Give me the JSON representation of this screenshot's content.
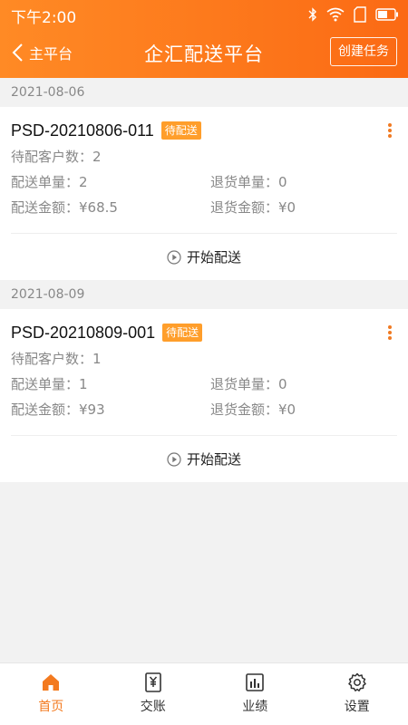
{
  "status_bar": {
    "time": "下午2:00"
  },
  "header": {
    "back_label": "主平台",
    "title": "企汇配送平台",
    "create_label": "创建任务"
  },
  "tasks": [
    {
      "date": "2021-08-06",
      "id": "PSD-20210806-011",
      "badge": "待配送",
      "pending_customers_label": "待配客户数：",
      "pending_customers": "2",
      "orders_label": "配送单量：",
      "orders": "2",
      "returns_label": "退货单量：",
      "returns": "0",
      "amount_label": "配送金额：",
      "amount": "¥68.5",
      "return_amount_label": "退货金额：",
      "return_amount": "¥0",
      "start_label": "开始配送"
    },
    {
      "date": "2021-08-09",
      "id": "PSD-20210809-001",
      "badge": "待配送",
      "pending_customers_label": "待配客户数：",
      "pending_customers": "1",
      "orders_label": "配送单量：",
      "orders": "1",
      "returns_label": "退货单量：",
      "returns": "0",
      "amount_label": "配送金额：",
      "amount": "¥93",
      "return_amount_label": "退货金额：",
      "return_amount": "¥0",
      "start_label": "开始配送"
    }
  ],
  "nav": [
    {
      "label": "首页",
      "icon": "home-icon",
      "active": true
    },
    {
      "label": "交账",
      "icon": "yen-receipt-icon",
      "active": false
    },
    {
      "label": "业绩",
      "icon": "bar-chart-icon",
      "active": false
    },
    {
      "label": "设置",
      "icon": "gear-icon",
      "active": false
    }
  ],
  "colors": {
    "accent": "#f37a1f",
    "header_start": "#ff8a25",
    "header_end": "#fb6a14",
    "badge": "#ff9e2b"
  }
}
